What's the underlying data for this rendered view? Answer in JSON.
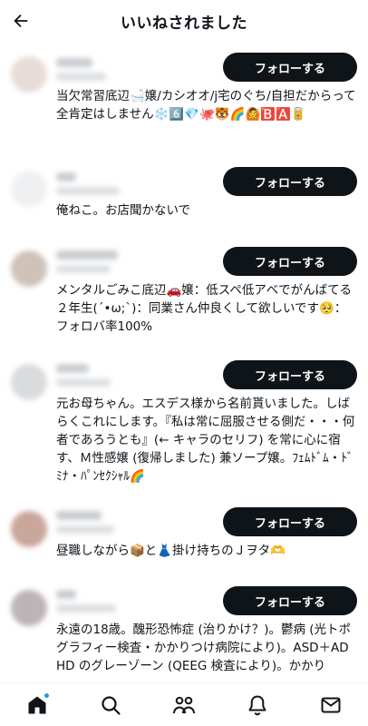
{
  "header": {
    "title": "いいねされました"
  },
  "follow_label": "フォローする",
  "users": [
    {
      "bio": "当欠常習底辺🛁嬢/カシオオ/j宅のぐち/自担だからって全肯定はしません❄️6️⃣💎🐙🐯🌈🙆🅱️🅰️🥫"
    },
    {
      "bio": "俺ねこ。お店聞かないで"
    },
    {
      "bio": "メンタルごみこ底辺🚗嬢：低スペ低アベでがんばてる２年生(´•ω;`)：同業さん仲良くして欲しいです🥺：フォロバ率100%"
    },
    {
      "bio": "元お母ちゃん。エスデス様から名前貰いました。しばらくこれにします。『私は常に屈服させる側だ・・・何者であろうとも』(← キャラのセリフ) を常に心に宿す、Ｍ性感嬢 (復帰しました) 兼ソープ嬢。ﾌｪﾑﾄﾞﾑ・ﾄﾞﾐﾅ・ﾊﾟﾝｾｸｼｬﾙ🌈"
    },
    {
      "bio": "昼職しながら📦と👗掛け持ちのＪヲタ🫶"
    },
    {
      "bio": "永遠の18歳。醜形恐怖症 (治りかけ？)。鬱病 (光トポグラフィー検査・かかりつけ病院により)。ASD＋ADHD のグレーゾーン (QEEG 検査により)。かかり"
    }
  ],
  "nav": [
    {
      "name": "home-icon",
      "active": true
    },
    {
      "name": "search-icon"
    },
    {
      "name": "communities-icon"
    },
    {
      "name": "notifications-icon"
    },
    {
      "name": "messages-icon"
    }
  ],
  "colors": {
    "button": "#0f1419",
    "accent": "#1d9bf0"
  }
}
